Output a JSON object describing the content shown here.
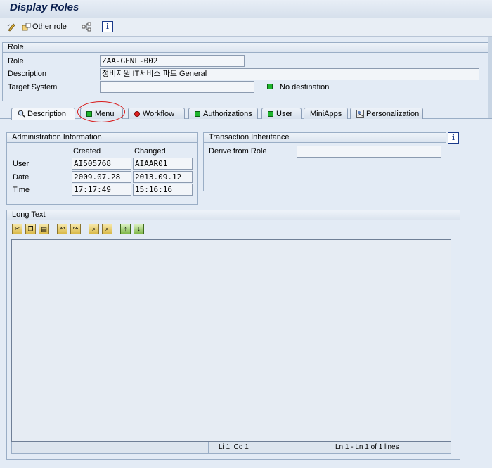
{
  "window": {
    "title": "Display Roles"
  },
  "toolbar": {
    "other_role_label": "Other role"
  },
  "role": {
    "group_title": "Role",
    "role_label": "Role",
    "role_value": "ZAA-GENL-002",
    "description_label": "Description",
    "description_value": "정비지원 IT서비스 파트 General",
    "target_system_label": "Target System",
    "target_system_value": "",
    "destination_status": "No destination"
  },
  "tabs": [
    {
      "label": "Description",
      "icon": "search-icon"
    },
    {
      "label": "Menu",
      "icon": "green-status-icon"
    },
    {
      "label": "Workflow",
      "icon": "red-status-icon"
    },
    {
      "label": "Authorizations",
      "icon": "green-status-icon"
    },
    {
      "label": "User",
      "icon": "green-status-icon"
    },
    {
      "label": "MiniApps",
      "icon": ""
    },
    {
      "label": "Personalization",
      "icon": "personalization-icon"
    }
  ],
  "admin": {
    "title": "Administration Information",
    "created_header": "Created",
    "changed_header": "Changed",
    "user_label": "User",
    "date_label": "Date",
    "time_label": "Time",
    "created_user": "AI505768",
    "changed_user": "AIAAR01",
    "created_date": "2009.07.28",
    "changed_date": "2013.09.12",
    "created_time": "17:17:49",
    "changed_time": "15:16:16"
  },
  "inheritance": {
    "title": "Transaction Inheritance",
    "derive_label": "Derive from Role",
    "derive_value": ""
  },
  "long_text": {
    "title": "Long Text",
    "status_position": "Li 1, Co 1",
    "status_lines": "Ln 1 - Ln 1 of 1 lines"
  },
  "colors": {
    "accent": "#0a1f4f",
    "background": "#e3ebf5",
    "status_green": "#1fb52c",
    "status_red": "#e02020",
    "annotation": "#d81a1a"
  }
}
